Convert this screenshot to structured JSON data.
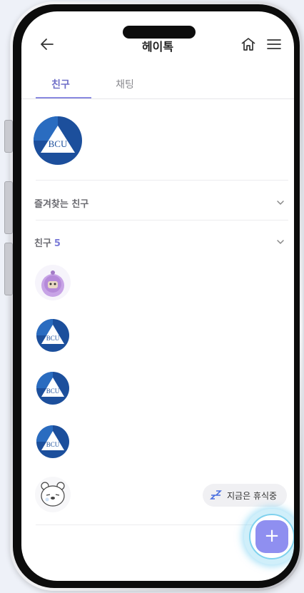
{
  "header": {
    "title": "헤이톡",
    "back_icon": "arrow-left-icon",
    "home_icon": "home-icon",
    "menu_icon": "hamburger-menu-icon"
  },
  "tabs": [
    {
      "label": "친구",
      "active": true
    },
    {
      "label": "채팅",
      "active": false
    }
  ],
  "profile": {
    "avatar_text": "BCU"
  },
  "sections": {
    "favorites": {
      "label": "즐겨찾는 친구"
    },
    "friends": {
      "label": "친구",
      "count": "5"
    }
  },
  "friends": [
    {
      "avatar": "purple-character-avatar"
    },
    {
      "avatar": "bcu-logo-avatar",
      "text": "BCU"
    },
    {
      "avatar": "bcu-logo-avatar",
      "text": "BCU"
    },
    {
      "avatar": "bcu-logo-avatar",
      "text": "BCU"
    },
    {
      "avatar": "bear-sketch-avatar"
    }
  ],
  "status": {
    "icon": "sleep-zz-icon",
    "label": "지금은 휴식중"
  },
  "fab": {
    "label": "+"
  },
  "colors": {
    "accent": "#6f6fc8",
    "fab": "#8f8ff0",
    "glow": "#7fd2ee",
    "bcu_blue": "#1c4f9c"
  }
}
